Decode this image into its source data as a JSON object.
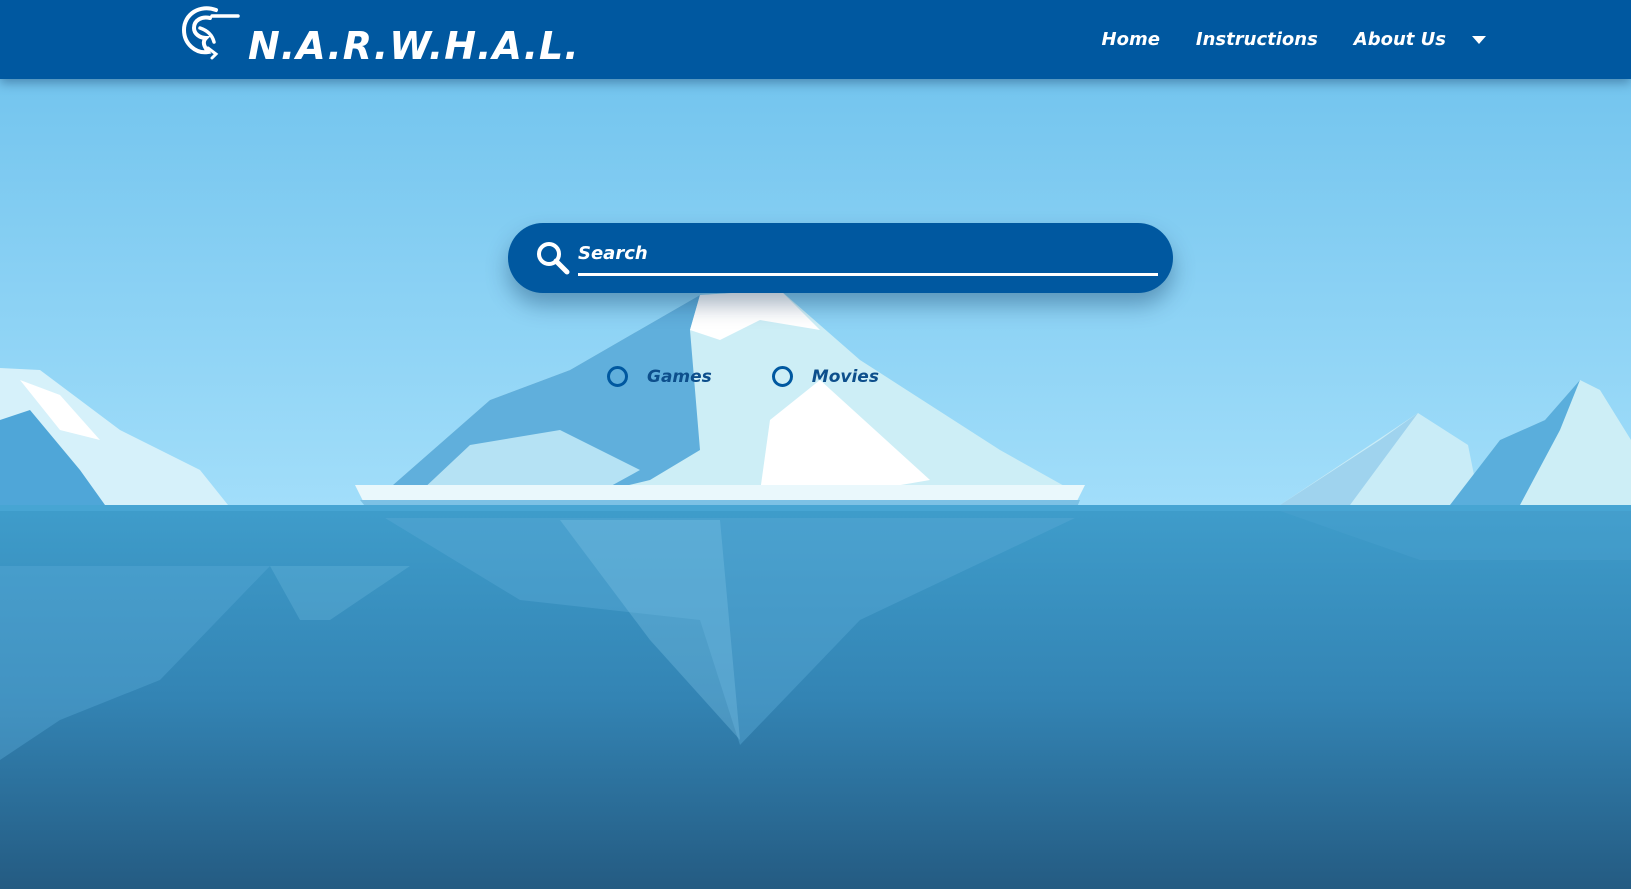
{
  "colors": {
    "navbar": "#0058a0",
    "sky_top": "#6bc0ec",
    "sky_bottom": "#9fdcf9",
    "water_top": "#3d9ac9",
    "water_bottom": "#255e86",
    "text_light": "#ffffff",
    "radio_accent": "#0058a0"
  },
  "header": {
    "brand": "N.A.R.W.H.A.L.",
    "logo_icon": "narwhal-icon",
    "nav": [
      {
        "label": "Home"
      },
      {
        "label": "Instructions"
      },
      {
        "label": "About Us"
      }
    ],
    "dropdown_icon": "caret-down-icon"
  },
  "search": {
    "icon": "search-icon",
    "placeholder": "Search",
    "value": ""
  },
  "options": [
    {
      "label": "Games",
      "selected": false
    },
    {
      "label": "Movies",
      "selected": false
    }
  ]
}
